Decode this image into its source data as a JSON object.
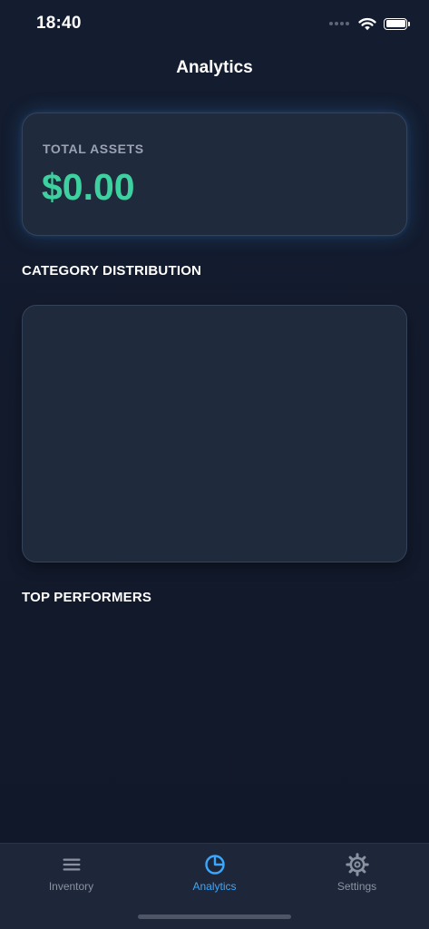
{
  "status_bar": {
    "time": "18:40"
  },
  "nav": {
    "title": "Analytics"
  },
  "assets_card": {
    "label": "TOTAL ASSETS",
    "value": "$0.00"
  },
  "sections": {
    "category_distribution": "CATEGORY DISTRIBUTION",
    "top_performers": "TOP PERFORMERS"
  },
  "tab_bar": {
    "tabs": [
      {
        "label": "Inventory",
        "icon": "list-icon",
        "selected": false
      },
      {
        "label": "Analytics",
        "icon": "pie-chart-icon",
        "selected": true
      },
      {
        "label": "Settings",
        "icon": "gear-icon",
        "selected": false
      }
    ]
  },
  "colors": {
    "background": "#121a2c",
    "card": "#1f2a3c",
    "accent_green": "#3ed1a0",
    "accent_blue": "#3aa7ff",
    "tab_inactive": "#8a92a2"
  },
  "icons": {
    "signal": "signal-dots-icon",
    "wifi": "wifi-icon",
    "battery": "battery-icon"
  }
}
